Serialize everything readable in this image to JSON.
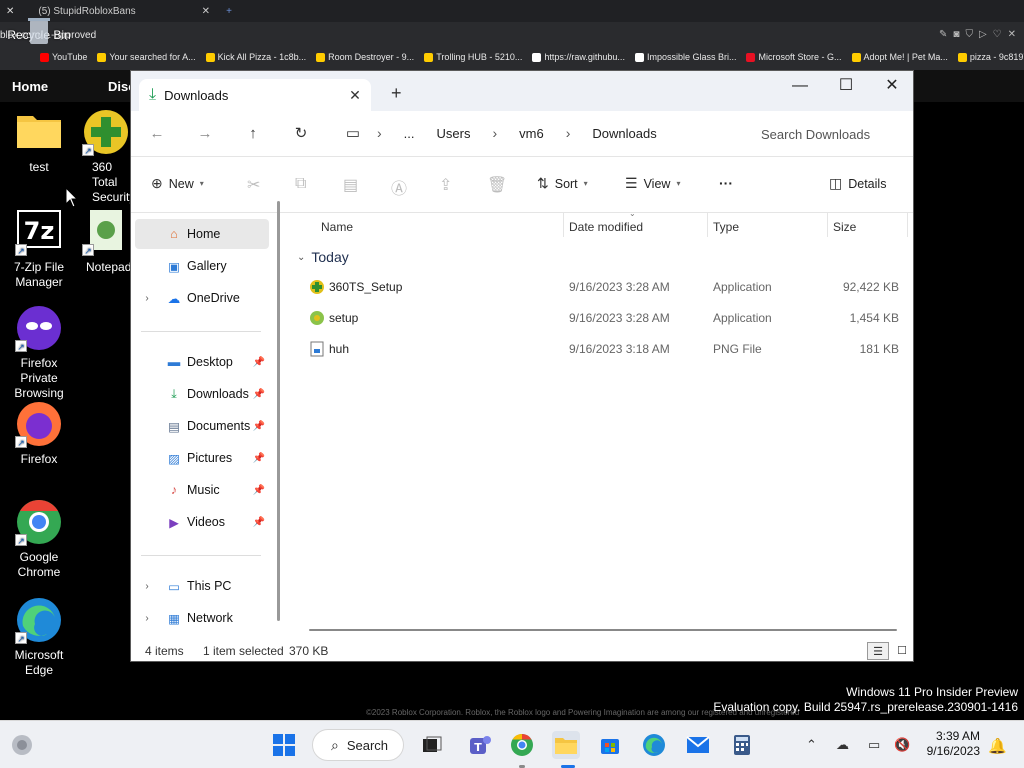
{
  "browser": {
    "tab_title": "(5) StupidRobloxBans",
    "url_text": "blox.com/...-approved",
    "bookmarks": [
      "YouTube",
      "Your searched for A...",
      "Kick All Pizza - 1c8b...",
      "Room Destroyer - 9...",
      "Trolling HUB - 5210...",
      "https://raw.githubu...",
      "Impossible Glass Bri...",
      "Microsoft Store - G...",
      "Adopt Me! | Pet Ma...",
      "pizza - 9c8197b1"
    ],
    "nav_home": "Home",
    "nav_discover": "Disc",
    "footer": "©2023 Roblox Corporation. Roblox, the Roblox logo and Powering Imagination are among our registered and unregistered"
  },
  "desktop": {
    "icons": [
      {
        "label": "Recycle Bin"
      },
      {
        "label": "test"
      },
      {
        "label": "360 Total Security"
      },
      {
        "label": "7-Zip File Manager"
      },
      {
        "label": "Notepad"
      },
      {
        "label": "Firefox Private Browsing"
      },
      {
        "label": "Firefox"
      },
      {
        "label": "Google Chrome"
      },
      {
        "label": "Microsoft Edge"
      }
    ],
    "watermark_line1": "Windows 11 Pro Insider Preview",
    "watermark_line2": "Evaluation copy. Build 25947.rs_prerelease.230901-1416"
  },
  "explorer": {
    "tab_title": "Downloads",
    "breadcrumb": [
      "...",
      "Users",
      "vm6",
      "Downloads"
    ],
    "search_placeholder": "Search Downloads",
    "commands": {
      "new": "New",
      "sort": "Sort",
      "view": "View",
      "more": "···",
      "details": "Details"
    },
    "nav": {
      "home": "Home",
      "gallery": "Gallery",
      "onedrive": "OneDrive",
      "desktop": "Desktop",
      "downloads": "Downloads",
      "documents": "Documents",
      "pictures": "Pictures",
      "music": "Music",
      "videos": "Videos",
      "this_pc": "This PC",
      "network": "Network"
    },
    "columns": {
      "name": "Name",
      "date": "Date modified",
      "type": "Type",
      "size": "Size"
    },
    "group": "Today",
    "files": [
      {
        "name": "360TS_Setup",
        "date": "9/16/2023 3:28 AM",
        "type": "Application",
        "size": "92,422 KB"
      },
      {
        "name": "setup",
        "date": "9/16/2023 3:28 AM",
        "type": "Application",
        "size": "1,454 KB"
      },
      {
        "name": "huh",
        "date": "9/16/2023 3:18 AM",
        "type": "PNG File",
        "size": "181 KB"
      }
    ],
    "status": {
      "count": "4 items",
      "selected": "1 item selected",
      "selected_size": "370 KB"
    }
  },
  "taskbar": {
    "search_label": "Search",
    "time": "3:39 AM",
    "date": "9/16/2023"
  }
}
